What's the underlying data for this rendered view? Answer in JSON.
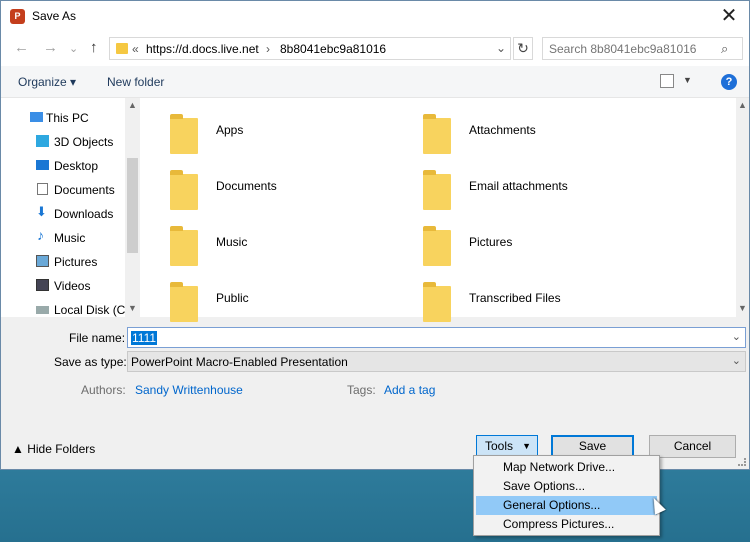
{
  "window": {
    "title": "Save As",
    "close_glyph": "✕"
  },
  "nav": {
    "back": "←",
    "forward": "→",
    "dropdown": "⌄",
    "up": "↑"
  },
  "address": {
    "chevrons": "«",
    "part1": "https://d.docs.live.net",
    "separator": "›",
    "part2": "8b8041ebc9a81016",
    "dropdown": "⌄"
  },
  "search": {
    "placeholder": "Search 8b8041ebc9a81016"
  },
  "toolbar": {
    "organize": "Organize ▾",
    "new_folder": "New folder",
    "help": "?"
  },
  "sidebar": {
    "items": [
      {
        "label": "This PC",
        "icon": "computer-icon"
      },
      {
        "label": "3D Objects",
        "icon": "cube-icon"
      },
      {
        "label": "Desktop",
        "icon": "desktop-icon"
      },
      {
        "label": "Documents",
        "icon": "document-icon"
      },
      {
        "label": "Downloads",
        "icon": "download-icon"
      },
      {
        "label": "Music",
        "icon": "music-icon"
      },
      {
        "label": "Pictures",
        "icon": "pictures-icon"
      },
      {
        "label": "Videos",
        "icon": "videos-icon"
      },
      {
        "label": "Local Disk (C:",
        "icon": "disk-icon"
      }
    ]
  },
  "folders": [
    {
      "label": "Apps"
    },
    {
      "label": "Attachments"
    },
    {
      "label": "Documents"
    },
    {
      "label": "Email attachments"
    },
    {
      "label": "Music"
    },
    {
      "label": "Pictures"
    },
    {
      "label": "Public"
    },
    {
      "label": "Transcribed Files"
    }
  ],
  "form": {
    "file_name_label": "File name:",
    "file_name_value": "1111",
    "save_type_label": "Save as type:",
    "save_type_value": "PowerPoint Macro-Enabled Presentation",
    "authors_label": "Authors:",
    "authors_value": "Sandy Writtenhouse",
    "tags_label": "Tags:",
    "tags_value": "Add a tag"
  },
  "footer": {
    "hide_folders": "▲ Hide Folders",
    "tools": "Tools",
    "save": "Save",
    "cancel": "Cancel"
  },
  "tools_menu": {
    "items": [
      {
        "label": "Map Network Drive..."
      },
      {
        "label": "Save Options..."
      },
      {
        "label": "General Options..."
      },
      {
        "label": "Compress Pictures..."
      }
    ]
  },
  "colors": {
    "accent": "#0078d7",
    "folder": "#f8d35e",
    "menu_highlight": "#91c9f7",
    "desktop": "#2a7494"
  }
}
